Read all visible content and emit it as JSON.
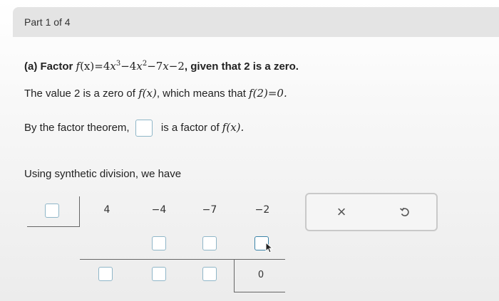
{
  "header": {
    "part_label": "Part 1 of 4"
  },
  "problem": {
    "label": "(a) Factor ",
    "func": "f",
    "arg": "(x)",
    "eq": "=4",
    "x1": "x",
    "exp1": "3",
    "mid1": "−4",
    "x2": "x",
    "exp2": "2",
    "rest": "−7",
    "x3": "x",
    "tail": "−2",
    "suffix": ", given that 2 is a zero."
  },
  "line2": {
    "prefix": "The value 2 is a zero of ",
    "fx": "f(x)",
    "middle": ", which means that ",
    "f2": "f(2)=0."
  },
  "line3": {
    "prefix": "By the factor theorem,",
    "suffix": "is a factor of ",
    "fx": "f(x)."
  },
  "line4": {
    "text": "Using synthetic division, we have"
  },
  "synthetic": {
    "coefficients": [
      "4",
      "−4",
      "−7",
      "−2"
    ],
    "remainder": "0"
  },
  "actions": {
    "clear_icon": "×",
    "undo_icon": "↻"
  }
}
